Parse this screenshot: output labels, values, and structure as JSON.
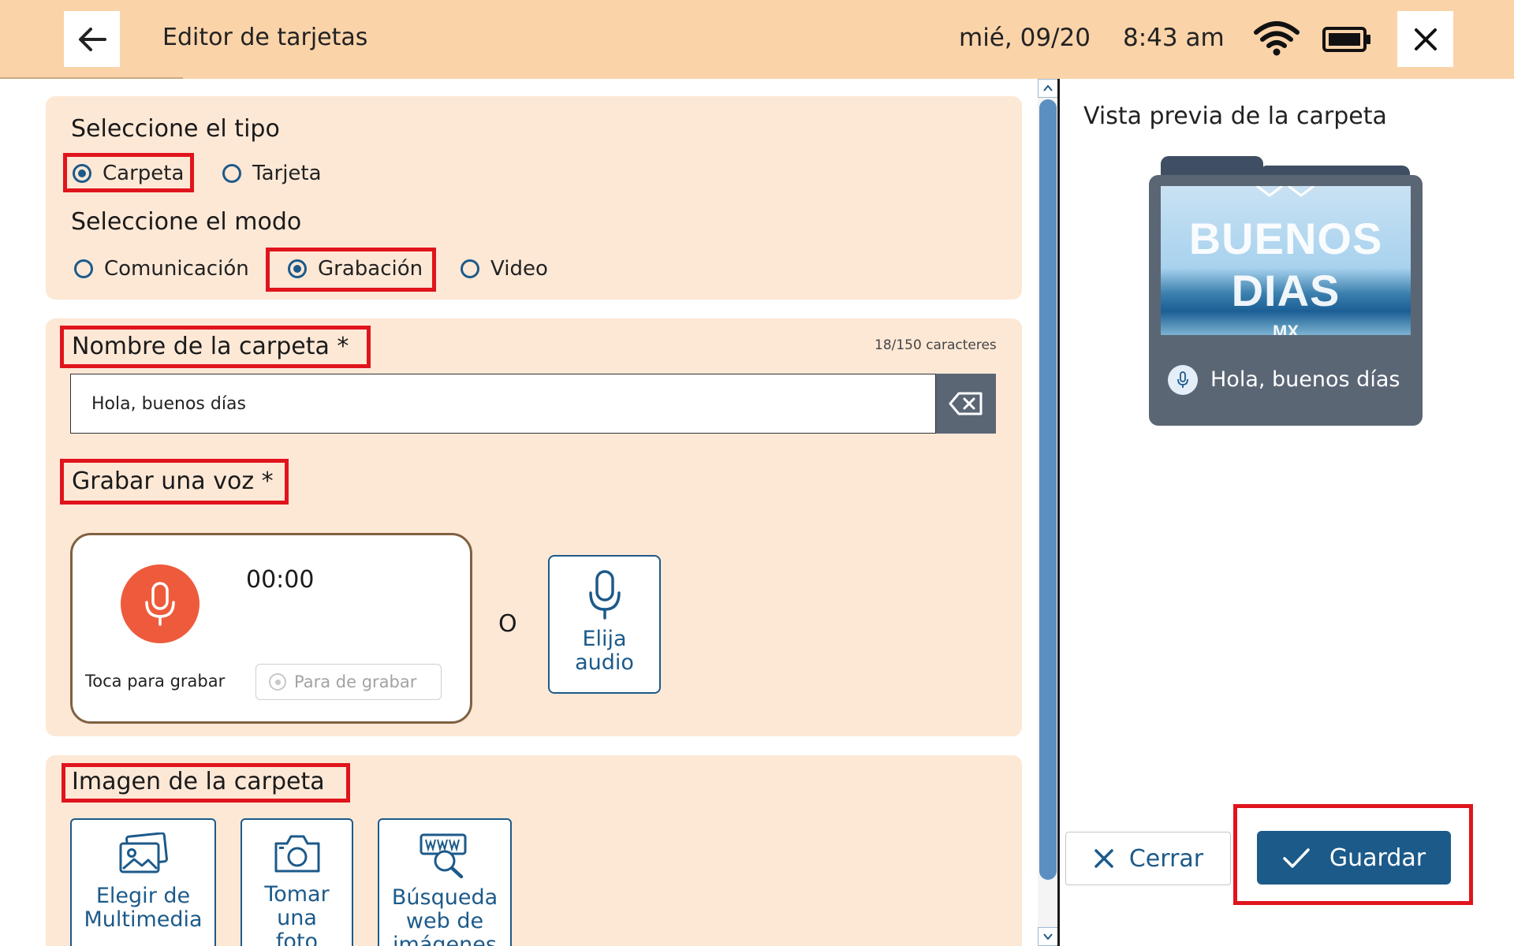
{
  "header": {
    "back_icon": "arrow-left-icon",
    "title": "Editor de tarjetas",
    "date": "mié, 09/20",
    "time": "8:43 am",
    "wifi_icon": "wifi-icon",
    "battery_icon": "battery-icon",
    "close_icon": "close-icon",
    "background": "#fbd3a9"
  },
  "type_section": {
    "title": "Seleccione el tipo",
    "options": [
      {
        "label": "Carpeta",
        "selected": true
      },
      {
        "label": "Tarjeta",
        "selected": false
      }
    ]
  },
  "mode_section": {
    "title": "Seleccione el modo",
    "options": [
      {
        "label": "Comunicación",
        "selected": false
      },
      {
        "label": "Grabación",
        "selected": true
      },
      {
        "label": "Video",
        "selected": false
      }
    ]
  },
  "name_section": {
    "title": "Nombre de la carpeta *",
    "char_count": "18/150 caracteres",
    "value": "Hola, buenos días",
    "clear_icon": "backspace-icon"
  },
  "voice_section": {
    "title": "Grabar una voz *",
    "timer": "00:00",
    "tap_label": "Toca para grabar",
    "stop_label": "Para de grabar",
    "or_label": "O",
    "choose_audio_label": "Elija audio"
  },
  "image_section": {
    "title": "Imagen de la carpeta",
    "tiles": [
      {
        "label": "Elegir de Multimedia",
        "icon": "gallery-icon"
      },
      {
        "label": "Tomar una foto",
        "icon": "camera-icon"
      },
      {
        "label": "Búsqueda web de imágenes",
        "icon": "web-search-icon"
      }
    ]
  },
  "preview": {
    "title": "Vista previa de la carpeta",
    "image_text_line1": "BUENOS",
    "image_text_line2": "DIAS",
    "image_text_line3": "MX",
    "label": "Hola, buenos días"
  },
  "actions": {
    "cancel_label": "Cerrar",
    "save_label": "Guardar"
  },
  "colors": {
    "accent": "#1c5a8a",
    "panel": "#fde8d6",
    "record": "#ee5b3c",
    "highlight": "#e0141c",
    "folder": "#5b6675"
  }
}
